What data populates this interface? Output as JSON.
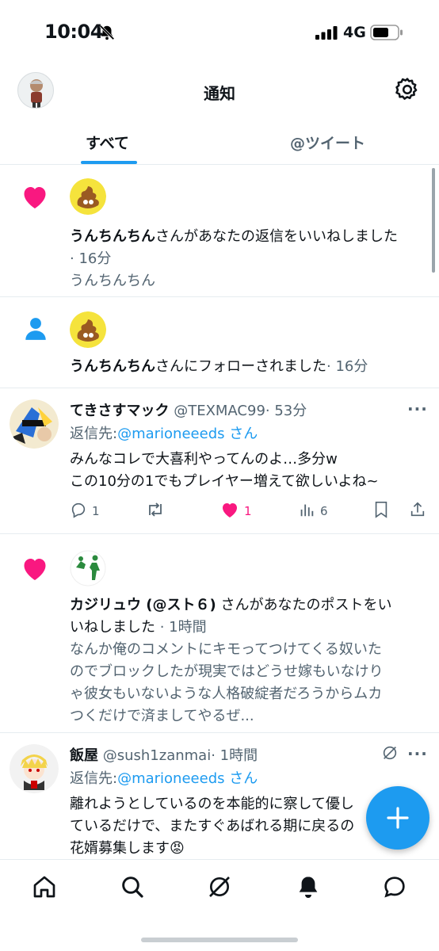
{
  "status_bar": {
    "time": "10:04",
    "network": "4G"
  },
  "header": {
    "title": "通知"
  },
  "tabs": [
    {
      "label": "すべて"
    },
    {
      "label": "@ツイート"
    }
  ],
  "notifications": [
    {
      "user": "うんちんちん",
      "action_text": "さんがあなたの返信をいいねしました",
      "time": "· 16分",
      "quote": "うんちんちん"
    },
    {
      "user": "うんちんちん",
      "action_text": "さんにフォローされました",
      "time": "· 16分"
    }
  ],
  "tweet1": {
    "name": "てきさすマック",
    "handle": "@TEXMAC99",
    "time": "· 53分",
    "reply_label": "返信先:",
    "reply_to": "@marioneeeds",
    "reply_suffix": "さん",
    "body_line1": "みんなコレで大喜利やってんのよ…多分w",
    "body_line2": "この10分の1でもプレイヤー増えて欲しいよね~",
    "replies": "1",
    "likes": "1",
    "views": "6"
  },
  "notification3": {
    "user": "カジリュウ (@スト６)",
    "action_line1": " さんがあなたのポストをい",
    "action_line2": "いねしました",
    "time": " · 1時間",
    "quote_line1": "なんか俺のコメントにキモってつけてくる奴いた",
    "quote_line2": "のでブロックしたが現実ではどうせ嫁もいなけり",
    "quote_line3": "ゃ彼女もいないような人格破綻者だろうからムカ",
    "quote_line4": "つくだけで済ましてやるぜ..."
  },
  "tweet2": {
    "name": "飯屋",
    "handle": "@sush1zanmai",
    "time": "· 1時間",
    "reply_label": "返信先:",
    "reply_to": "@marioneeeds",
    "reply_suffix": "さん",
    "body_line1": "離れようとしているのを本能的に察して優し",
    "body_line2": "ているだけで、またすぐあばれる期に戻るの",
    "body_line3": "花婿募集します",
    "emoji": "😡"
  },
  "colors": {
    "accent": "#1d9bf0",
    "like": "#f91880",
    "muted": "#536471"
  },
  "icons": [
    "bell-slash-icon",
    "signal-icon",
    "battery-icon",
    "gear-icon",
    "heart-icon",
    "person-icon",
    "reply-icon",
    "retweet-icon",
    "views-icon",
    "bookmark-icon",
    "share-icon",
    "grok-icon",
    "plus-icon",
    "home-icon",
    "search-icon",
    "bell-icon",
    "messages-icon"
  ]
}
